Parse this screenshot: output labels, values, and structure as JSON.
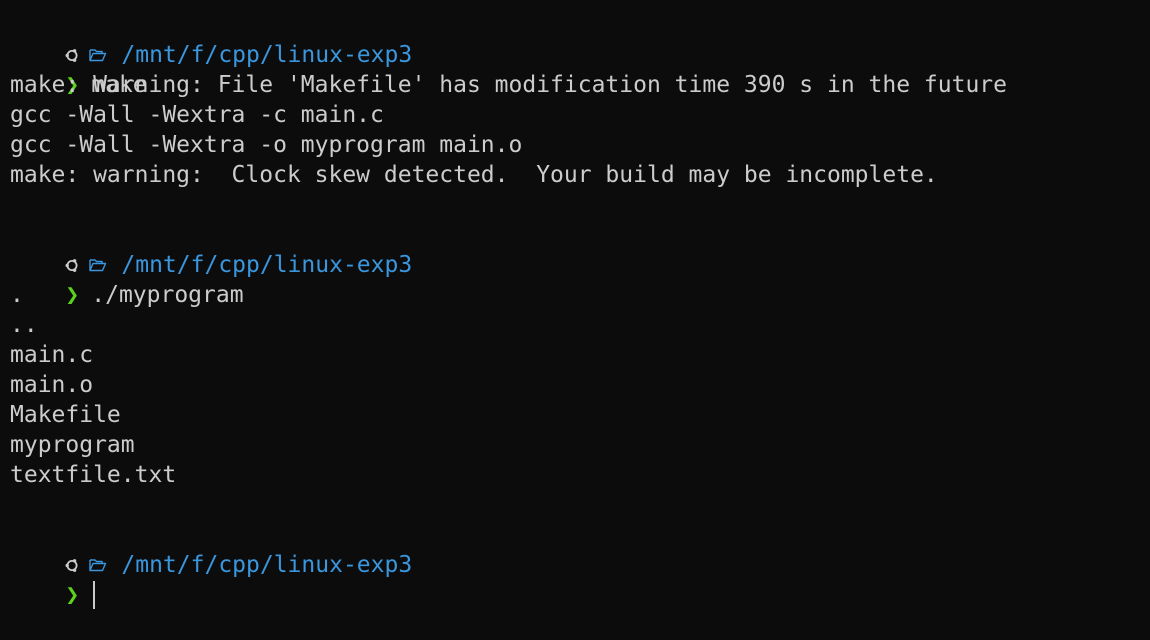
{
  "colors": {
    "background": "#0c0c0c",
    "text": "#cccccc",
    "path": "#3a96dd",
    "caret": "#5dd21c"
  },
  "icons": {
    "os": "ubuntu-logo-icon",
    "folder": "folder-open-icon"
  },
  "prompt": {
    "caret": "❯"
  },
  "blocks": [
    {
      "path": "/mnt/f/cpp/linux-exp3",
      "command": "make",
      "output": [
        "make: Warning: File 'Makefile' has modification time 390 s in the future",
        "gcc -Wall -Wextra -c main.c",
        "gcc -Wall -Wextra -o myprogram main.o",
        "make: warning:  Clock skew detected.  Your build may be incomplete."
      ]
    },
    {
      "path": "/mnt/f/cpp/linux-exp3",
      "command": "./myprogram",
      "output": [
        ".",
        "..",
        "main.c",
        "main.o",
        "Makefile",
        "myprogram",
        "textfile.txt"
      ]
    },
    {
      "path": "/mnt/f/cpp/linux-exp3",
      "command": "",
      "output": []
    }
  ]
}
